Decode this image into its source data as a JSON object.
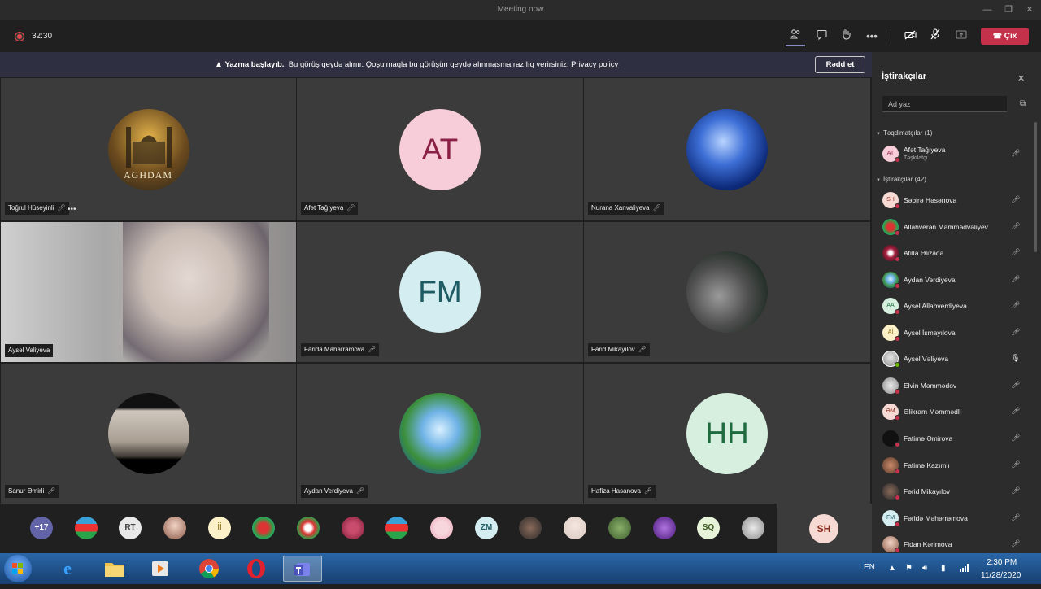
{
  "window": {
    "title": "Meeting now"
  },
  "toolbar": {
    "timer": "32:30",
    "leave_label": "Çıx"
  },
  "banner": {
    "bold": "Yazma başlayıb.",
    "text": "Bu görüş qeydə alınır. Qoşulmaqla bu görüşün qeydə alınmasına razılıq verirsiniz.",
    "link": "Privacy policy",
    "dismiss_label": "Rədd et"
  },
  "tiles": [
    {
      "name": "Toğrul Hüseyinli",
      "avatar_text": "AGHDAM",
      "type": "image"
    },
    {
      "name": "Afət Tağıyeva",
      "avatar_text": "AT",
      "type": "initials"
    },
    {
      "name": "Nurana Xanvaliyeva",
      "type": "image"
    },
    {
      "name": "Aysel Valiyeva",
      "type": "video"
    },
    {
      "name": "Fərida Maharramova",
      "avatar_text": "FM",
      "type": "initials"
    },
    {
      "name": "Farid Mikayılov",
      "type": "image"
    },
    {
      "name": "Sanur Əmirli",
      "type": "image"
    },
    {
      "name": "Aydan Verdiyeva",
      "type": "image"
    },
    {
      "name": "Hafiza Hasanova",
      "avatar_text": "HH",
      "type": "initials"
    }
  ],
  "strip": {
    "overflow_label": "+17",
    "initials": [
      "RT",
      "İİ",
      "ZM",
      "SQ"
    ],
    "self_initials": "SH"
  },
  "panel": {
    "title": "İştirakçılar",
    "search_placeholder": "Ad yaz",
    "presenters_label": "Təqdimatçılar (1)",
    "attendees_label": "İştirakçılar (42)",
    "presenter": {
      "name": "Afət Tağıyeva",
      "role": "Təşkilatçı",
      "initials": "AT"
    },
    "attendees": [
      {
        "name": "Səbirə Həsənova",
        "initials": "SH"
      },
      {
        "name": "Allahverən Məmmədvəliyev",
        "initials": ""
      },
      {
        "name": "Atilla Əlizadə",
        "initials": ""
      },
      {
        "name": "Aydan Verdiyeva",
        "initials": ""
      },
      {
        "name": "Aysel Allahverdiyeva",
        "initials": "AA"
      },
      {
        "name": "Aysel İsmayılova",
        "initials": "Aİ"
      },
      {
        "name": "Aysel Vəliyeva",
        "initials": ""
      },
      {
        "name": "Elvin Məmmədov",
        "initials": ""
      },
      {
        "name": "Əlikram Məmmədli",
        "initials": "ƏM"
      },
      {
        "name": "Fatimə Əmirova",
        "initials": ""
      },
      {
        "name": "Fatimə Kazımlı",
        "initials": ""
      },
      {
        "name": "Fərid Mikayılov",
        "initials": ""
      },
      {
        "name": "Fəridə Məhərrəmova",
        "initials": "FM"
      },
      {
        "name": "Fidan Kərimova",
        "initials": ""
      }
    ]
  },
  "taskbar": {
    "lang": "EN",
    "time": "2:30 PM",
    "date": "11/28/2020"
  }
}
